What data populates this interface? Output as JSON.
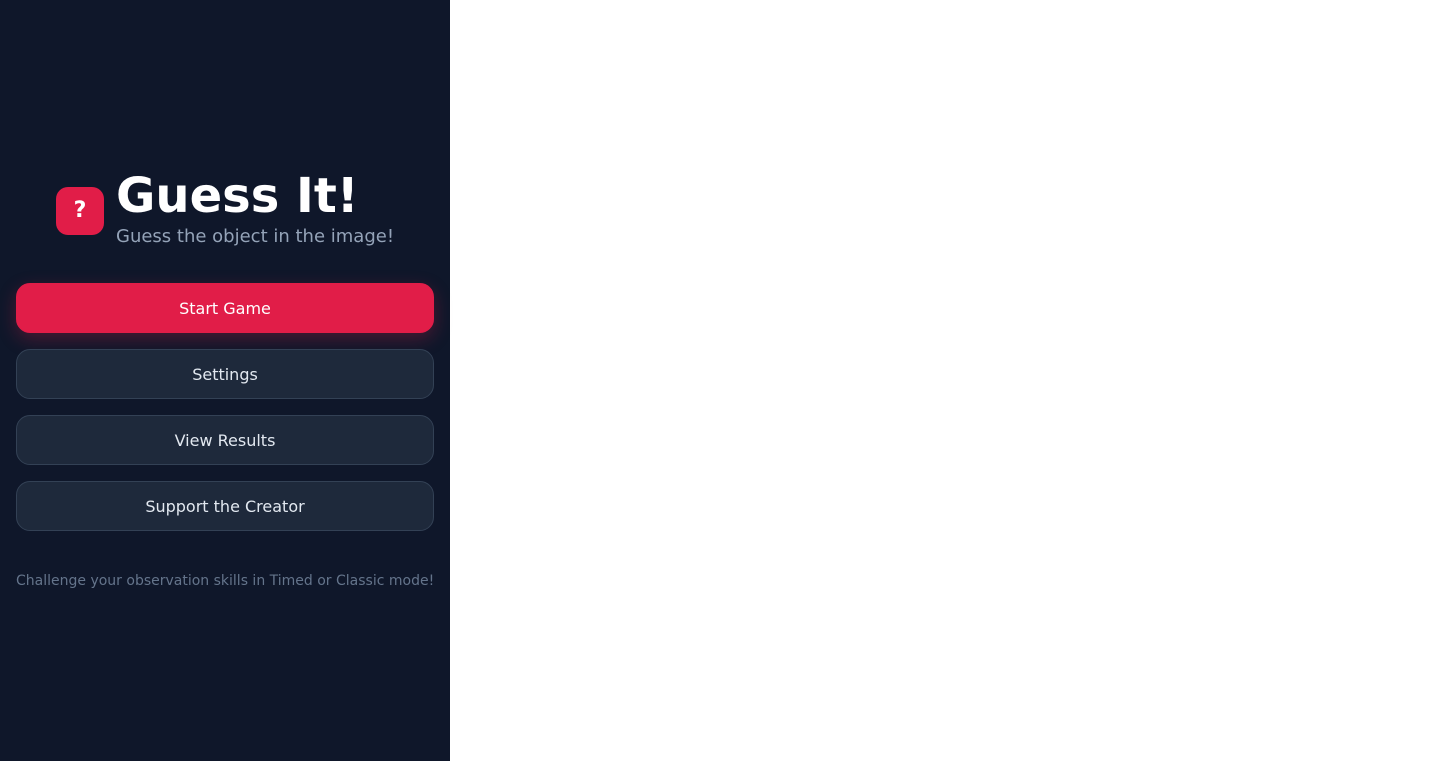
{
  "brand": {
    "logo_glyph": "?",
    "logo_icon": "question-mark-icon",
    "title": "Guess It!",
    "subtitle": "Guess the object in the image!"
  },
  "menu": {
    "start_label": "Start Game",
    "settings_label": "Settings",
    "results_label": "View Results",
    "support_label": "Support the Creator"
  },
  "footer": {
    "tagline": "Challenge your observation skills in Timed or Classic mode!"
  },
  "colors": {
    "sidebar_bg": "#0f172a",
    "accent": "#e11d48",
    "button_bg": "#1e293b",
    "main_bg": "#ffffff"
  }
}
